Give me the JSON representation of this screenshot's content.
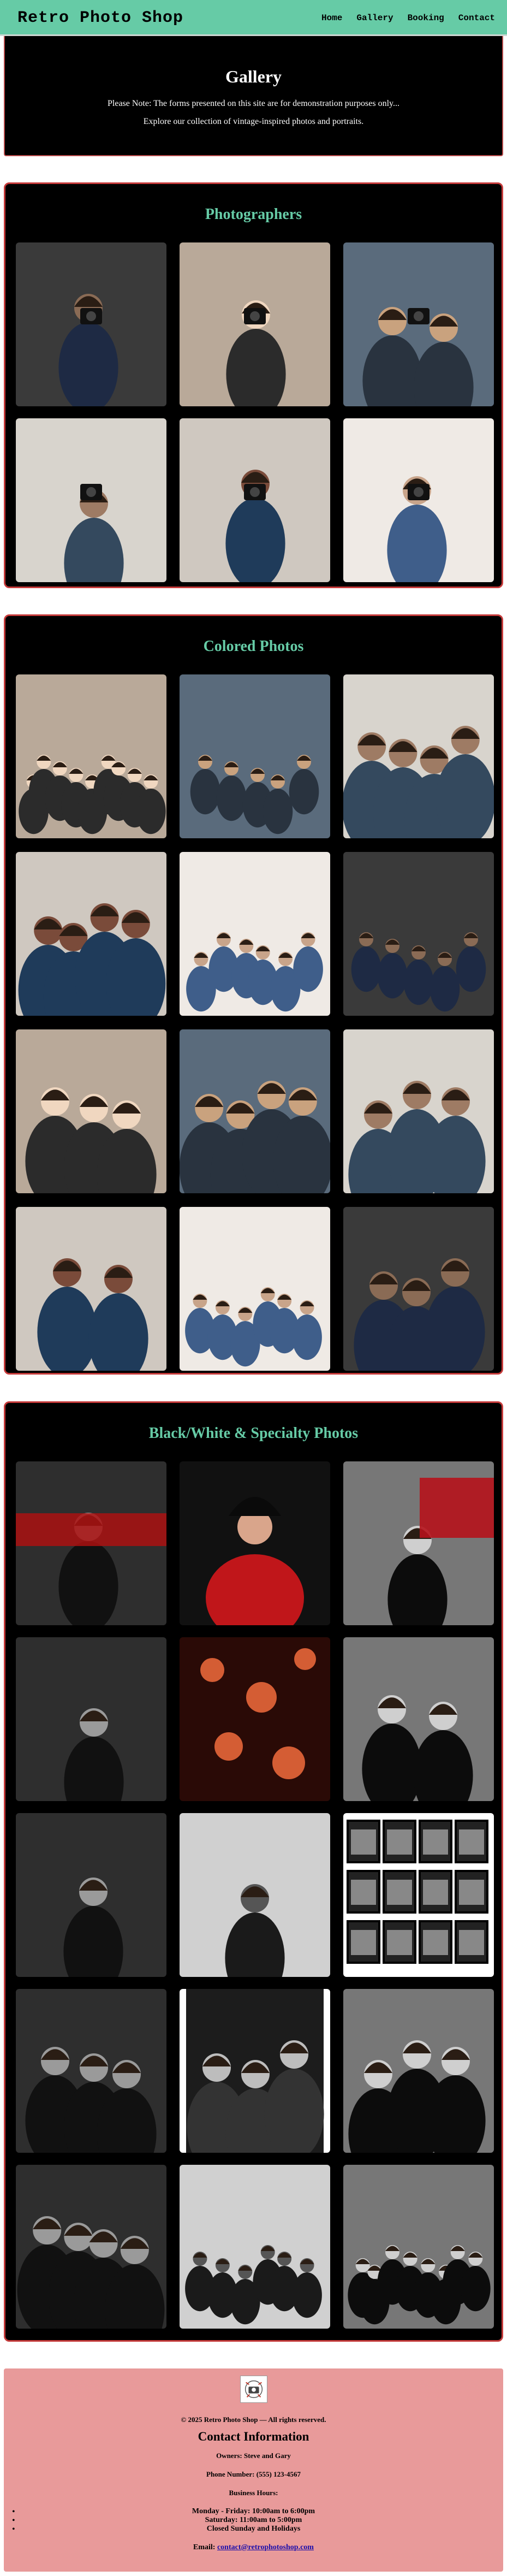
{
  "nav": {
    "brand": "Retro Photo Shop",
    "links": [
      "Home",
      "Gallery",
      "Booking",
      "Contact"
    ]
  },
  "hero": {
    "title": "Gallery",
    "note": "Please Note: The forms presented on this site are for demonstration purposes only...",
    "subtitle": "Explore our collection of vintage-inspired photos and portraits."
  },
  "sections": [
    {
      "title": "Photographers",
      "count": 6
    },
    {
      "title": "Colored Photos",
      "count": 12
    },
    {
      "title": "Black/White & Specialty Photos",
      "count": 15
    }
  ],
  "footer": {
    "copyright": "© 2025 Retro Photo Shop — All rights reserved.",
    "contact_heading": "Contact Information",
    "owners": "Owners: Steve and Gary",
    "phone": "Phone Number: (555) 123-4567",
    "hours_heading": "Business Hours:",
    "hours": [
      "Monday - Friday: 10:00am to 6:00pm",
      "Saturday: 11:00am to 5:00pm",
      "Closed Sunday and Holidays"
    ],
    "email_label": "Email:",
    "email": "contact@retrophotoshop.com"
  },
  "colors": {
    "accent": "#66cba6",
    "panel_border": "#c63a3a",
    "footer_bg": "#e89a9a"
  }
}
